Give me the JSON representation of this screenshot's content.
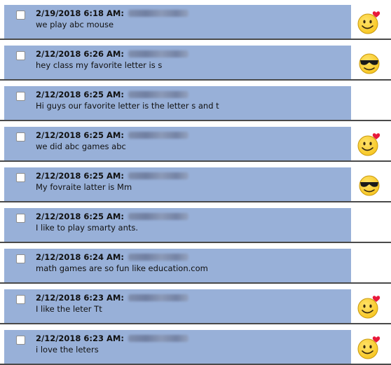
{
  "posts": [
    {
      "timestamp": "2/19/2018 6:18 AM:",
      "message": "we play abc mouse",
      "reaction": "heart-smiley-icon"
    },
    {
      "timestamp": "2/12/2018 6:26 AM:",
      "message": "hey class my favorite letter is s",
      "reaction": "sunglasses-smiley-icon"
    },
    {
      "timestamp": "2/12/2018 6:25 AM:",
      "message": "Hi guys our favorite letter is the letter s and t",
      "reaction": ""
    },
    {
      "timestamp": "2/12/2018 6:25 AM:",
      "message": "we did abc games abc",
      "reaction": "heart-smiley-icon"
    },
    {
      "timestamp": "2/12/2018 6:25 AM:",
      "message": "My fovraite latter is Mm",
      "reaction": "sunglasses-smiley-icon"
    },
    {
      "timestamp": "2/12/2018 6:25 AM:",
      "message": "I like to play smarty ants.",
      "reaction": ""
    },
    {
      "timestamp": "2/12/2018 6:24 AM:",
      "message": "math games are so fun like education.com",
      "reaction": ""
    },
    {
      "timestamp": "2/12/2018 6:23 AM:",
      "message": "I like the leter Tt",
      "reaction": "heart-smiley-icon"
    },
    {
      "timestamp": "2/12/2018 6:23 AM:",
      "message": "i love the leters",
      "reaction": "heart-smiley-icon"
    }
  ],
  "colors": {
    "card": "#98b0d8",
    "divider": "#4a4a4a",
    "smiley": "#f7c51f",
    "heart": "#e8193a"
  }
}
